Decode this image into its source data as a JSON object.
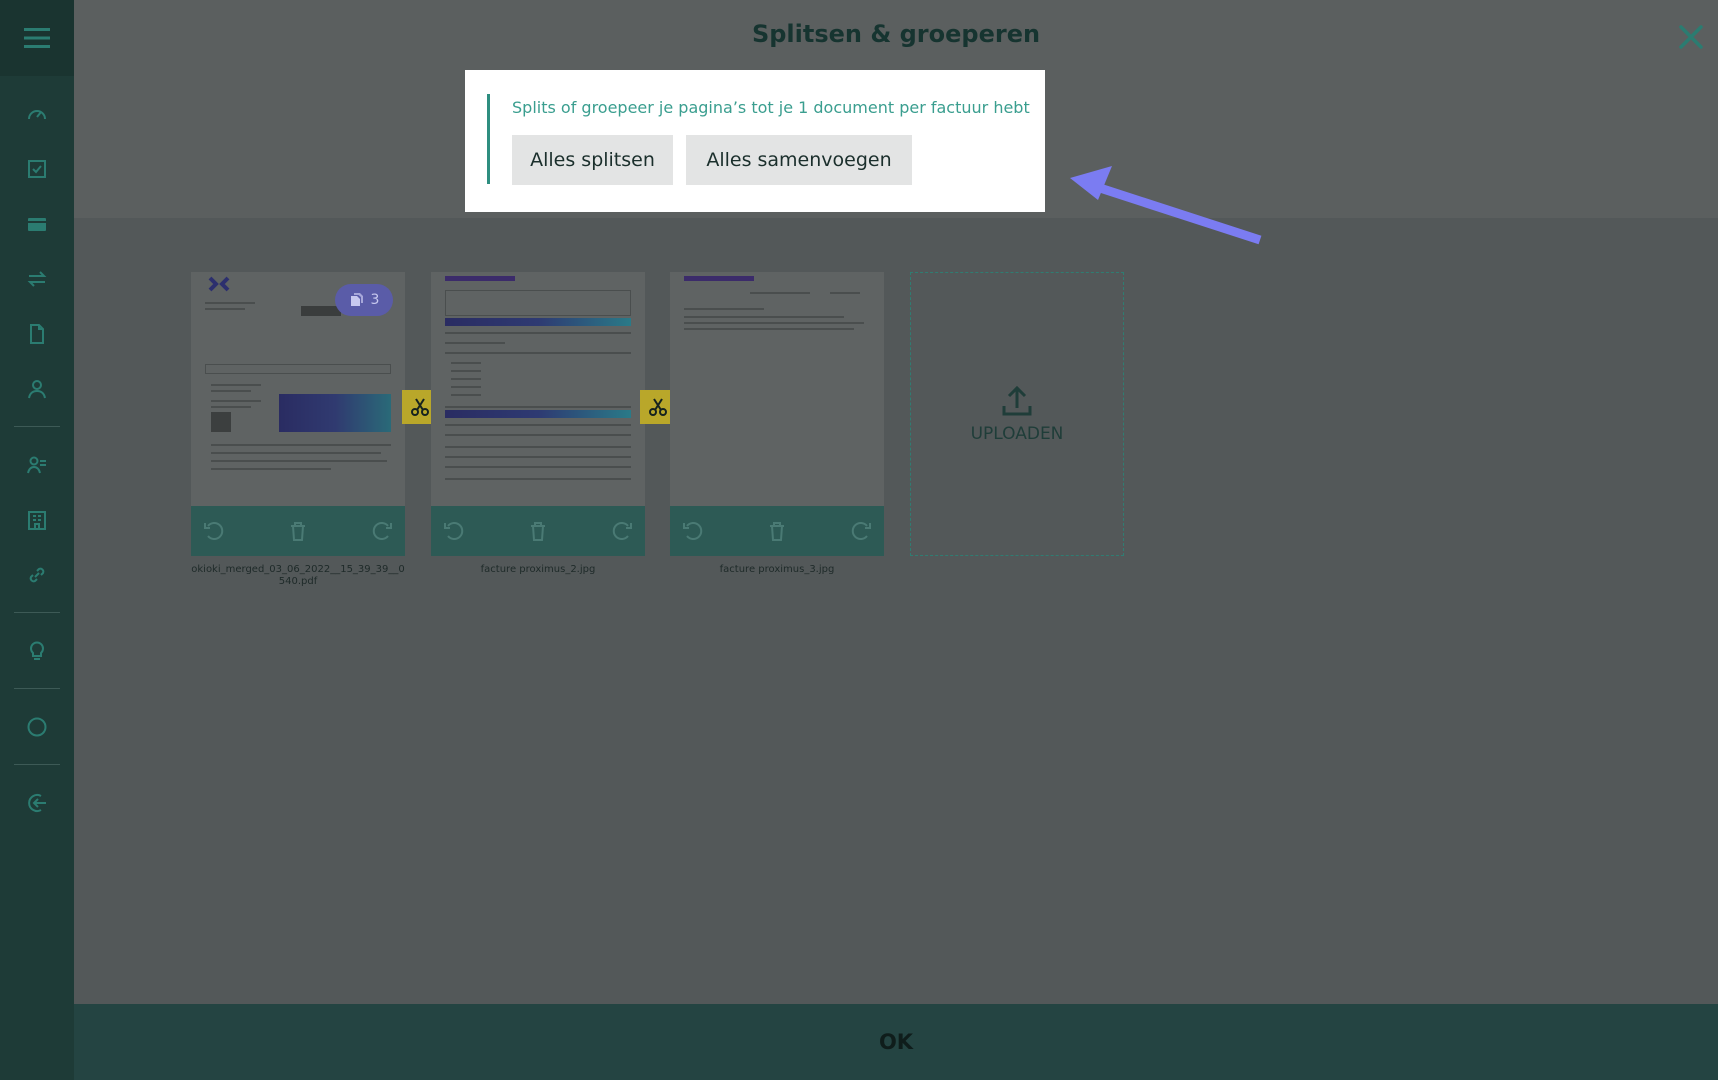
{
  "header": {
    "title": "Splitsen & groeperen"
  },
  "popover": {
    "hint": "Splits of groepeer je pagina’s tot je 1 document per factuur hebt",
    "split_all": "Alles splitsen",
    "merge_all": "Alles samenvoegen"
  },
  "documents": [
    {
      "filename": "okioki_merged_03_06_2022__15_39_39__0 540.pdf",
      "page_count": "3"
    },
    {
      "filename": "facture proximus_2.jpg"
    },
    {
      "filename": "facture proximus_3.jpg"
    }
  ],
  "upload": {
    "label": "UPLOADEN"
  },
  "footer": {
    "ok_label": "OK"
  },
  "sidebar": {
    "icons": [
      "menu-icon",
      "dashboard-icon",
      "checklist-icon",
      "card-icon",
      "transfer-icon",
      "document-icon",
      "users-icon",
      "contact-icon",
      "building-icon",
      "link-icon",
      "lightbulb-icon",
      "circle-icon",
      "logout-icon"
    ]
  },
  "colors": {
    "accent": "#3a9e8f",
    "sidebar": "#1e3b37",
    "footer": "#244442",
    "arrow": "#7b7cf2",
    "scissor": "#b9a72a"
  }
}
